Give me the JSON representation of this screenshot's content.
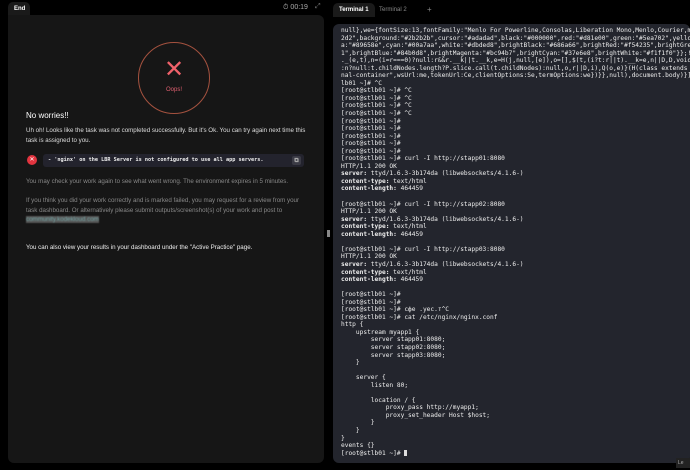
{
  "left": {
    "tab_label": "End",
    "timer": "00:19",
    "status_label": "Oops!",
    "heading": "No worries!!",
    "intro": "Uh oh! Looks like the task was not completed successfully. But it's Ok. You can try again next time this task is assigned to you.",
    "error_message": "- 'nginx' on the LBR Server is not configured to use all app servers.",
    "check_text": "You may check your work again to see what went wrong. The environment expires in 5 minutes.",
    "review_text": "If you think you did your work correctly and is marked failed, you may request for a review from your task dashboard. Or alternatively please submit outputs/screenshot(s) of your work and post to ",
    "link": "community.kodekloud.com",
    "dashboard_text": "You can also view your results in your dashboard under the \"Active Practice\" page."
  },
  "right": {
    "tabs": [
      "Terminal 1",
      "Terminal 2"
    ],
    "add_tab": "+",
    "corner_label": "Le",
    "lines": [
      "null},we={fontSize:13,fontFamily:\"Menlo For Powerline,Consolas,Liberation Mono,Menlo,Courier,monosp",
      "2d2\",background:\"#2b2b2b\",cursor:\"#adadad\",black:\"#000000\",red:\"#d81e00\",green:\"#5ea702\",yellow:\"#",
      "a:\"#89658e\",cyan:\"#00a7aa\",white:\"#dbded8\",brightBlack:\"#686a66\",brightRed:\"#f54235\",brightGreen:\"#",
      "1\",brightBlue:\"#84b0d8\",brightMagenta:\"#bc94b7\",brightCyan:\"#37e6e8\",brightWhite:\"#f1f1f0\"}};!func",
      "._(e,t),n=(i=r===0)?null:r&&r.__k||t.__k,e=H(j,null,[e]),o=[],$(t,(i?t:r||t).__k=e,n||D,D,void 0!",
      ":n?null:t.childNodes.length?P.slice.call(t.childNodes):null,o,r||D,i),Q(o,e)}(H(class extends U{re",
      "nal-container\",wsUrl:me,tokenUrl:Ce,clientOptions:Se,termOptions:we})}},null),document.body)}]);</",
      "lb01 ~]# ^C",
      "[root@stlb01 ~]# ^C",
      "[root@stlb01 ~]# ^C",
      "[root@stlb01 ~]# ^C",
      "[root@stlb01 ~]# ^C",
      "[root@stlb01 ~]#",
      "[root@stlb01 ~]#",
      "[root@stlb01 ~]#",
      "[root@stlb01 ~]#",
      "[root@stlb01 ~]#",
      "[root@stlb01 ~]# curl -I http://stapp01:8080",
      "HTTP/1.1 200 OK",
      "server: ttyd/1.6.3-3b174da (libwebsockets/4.1.6-)",
      "content-type: text/html",
      "content-length: 464459",
      "",
      "[root@stlb01 ~]# curl -I http://stapp02:8080",
      "HTTP/1.1 200 OK",
      "server: ttyd/1.6.3-3b174da (libwebsockets/4.1.6-)",
      "content-type: text/html",
      "content-length: 464459",
      "",
      "[root@stlb01 ~]# curl -I http://stapp03:8080",
      "HTTP/1.1 200 OK",
      "server: ttyd/1.6.3-3b174da (libwebsockets/4.1.6-)",
      "content-type: text/html",
      "content-length: 464459",
      "",
      "[root@stlb01 ~]#",
      "[root@stlb01 ~]#",
      "[root@stlb01 ~]# cфe .yec.т^C",
      "[root@stlb01 ~]# cat /etc/nginx/nginx.conf",
      "http {",
      "    upstream myapp1 {",
      "        server stapp01:8080;",
      "        server stapp02:8080;",
      "        server stapp03:8080;",
      "    }",
      "",
      "    server {",
      "        listen 80;",
      "",
      "        location / {",
      "            proxy_pass http://myapp1;",
      "            proxy_set_header Host $host;",
      "        }",
      "    }",
      "}",
      "events {}",
      "[root@stlb01 ~]# "
    ]
  }
}
